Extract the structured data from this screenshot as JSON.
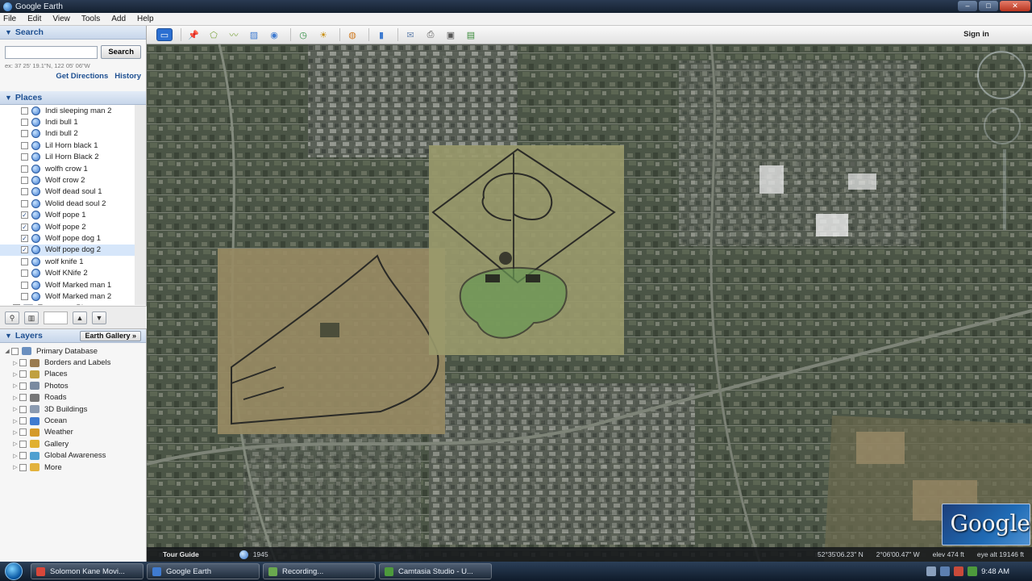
{
  "window": {
    "title": "Google Earth"
  },
  "menu": [
    "File",
    "Edit",
    "View",
    "Tools",
    "Add",
    "Help"
  ],
  "search": {
    "header": "Search",
    "button": "Search",
    "hint": "ex: 37 25' 19.1\"N, 122 05' 06\"W",
    "get_directions": "Get Directions",
    "history": "History"
  },
  "places": {
    "header": "Places",
    "items": [
      {
        "label": "Indi sleeping man 2",
        "checked": false
      },
      {
        "label": "Indi bull 1",
        "checked": false
      },
      {
        "label": "Indi bull 2",
        "checked": false
      },
      {
        "label": "Lil Horn black 1",
        "checked": false
      },
      {
        "label": "Lil Horn Black 2",
        "checked": false
      },
      {
        "label": "wolfh crow 1",
        "checked": false
      },
      {
        "label": "Wolf crow 2",
        "checked": false
      },
      {
        "label": "Wolf dead soul 1",
        "checked": false
      },
      {
        "label": "Wolid dead soul 2",
        "checked": false
      },
      {
        "label": "Wolf pope 1",
        "checked": true
      },
      {
        "label": "Wolf pope 2",
        "checked": true
      },
      {
        "label": "Wolf pope dog 1",
        "checked": true
      },
      {
        "label": "Wolf pope dog 2",
        "checked": true,
        "selected": true
      },
      {
        "label": "wolf knife 1",
        "checked": false
      },
      {
        "label": "Wolf KNife 2",
        "checked": false
      },
      {
        "label": "Wolf Marked man 1",
        "checked": false
      },
      {
        "label": "Wolf Marked man 2",
        "checked": false
      }
    ],
    "temporary": "Temporary Places"
  },
  "layers": {
    "header": "Layers",
    "gallery_button": "Earth Gallery",
    "items": [
      {
        "label": "Primary Database",
        "color": "#6a8fbf"
      },
      {
        "label": "Borders and Labels",
        "color": "#9a7b4f"
      },
      {
        "label": "Places",
        "color": "#c0a040"
      },
      {
        "label": "Photos",
        "color": "#7a8aa0"
      },
      {
        "label": "Roads",
        "color": "#777777"
      },
      {
        "label": "3D Buildings",
        "color": "#8a9ab0"
      },
      {
        "label": "Ocean",
        "color": "#3f7bd0"
      },
      {
        "label": "Weather",
        "color": "#d49a2a"
      },
      {
        "label": "Gallery",
        "color": "#e0b030"
      },
      {
        "label": "Global Awareness",
        "color": "#4fa0d0"
      },
      {
        "label": "More",
        "color": "#e3b23c"
      }
    ]
  },
  "toolbar": {
    "signin": "Sign in"
  },
  "status": {
    "tour_guide": "Tour Guide",
    "year": "1945",
    "lat": "52°35'06.23\" N",
    "lon": "2°06'00.47\" W",
    "elev": "elev 474 ft",
    "eye_alt": "eye alt 19146 ft"
  },
  "logo": {
    "text": "Google"
  },
  "taskbar": {
    "items": [
      {
        "label": "Solomon Kane Movi...",
        "color": "#d9473a"
      },
      {
        "label": "Google Earth",
        "color": "#3f7bd0"
      },
      {
        "label": "Recording...",
        "color": "#6aa84f"
      },
      {
        "label": "Camtasia Studio - U...",
        "color": "#4d9a3c"
      }
    ],
    "clock": "9:48 AM"
  }
}
